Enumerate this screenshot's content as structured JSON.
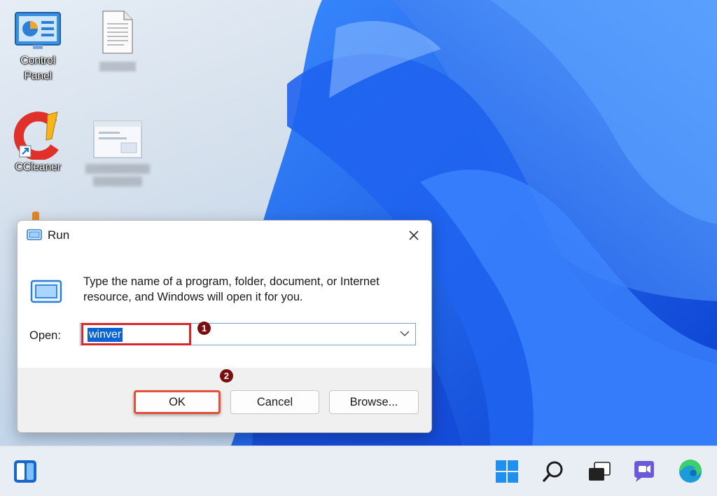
{
  "desktop": {
    "icons": [
      {
        "label_line1": "Control",
        "label_line2": "Panel"
      },
      {
        "label": "CCleaner"
      }
    ]
  },
  "dialog": {
    "title": "Run",
    "description": "Type the name of a program, folder, document, or Internet resource, and Windows will open it for you.",
    "open_label": "Open:",
    "open_value": "winver",
    "buttons": {
      "ok": "OK",
      "cancel": "Cancel",
      "browse": "Browse..."
    },
    "badges": [
      "1",
      "2"
    ]
  },
  "colors": {
    "highlight_box": "#d9262b",
    "badge": "#7a0d0d",
    "selection": "#0a64d6"
  },
  "taskbar": {
    "icons": [
      "widgets-icon",
      "start-icon",
      "search-icon",
      "task-view-icon",
      "teams-chat-icon",
      "edge-icon"
    ]
  }
}
